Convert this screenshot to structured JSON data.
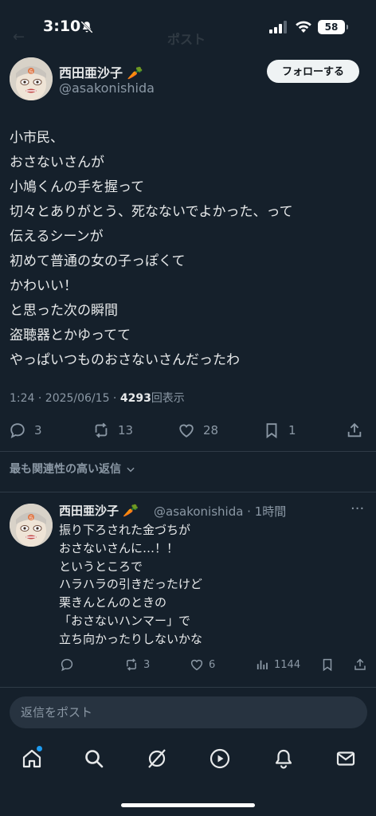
{
  "status_bar": {
    "time": "3:10",
    "battery": "58"
  },
  "header": {
    "back": "←",
    "title": "ポスト"
  },
  "tweet": {
    "author_name": "西田亜沙子",
    "author_emoji": "🥕",
    "author_handle": "@asakonishida",
    "follow_label": "フォローする",
    "lines": [
      "小市民、",
      "おさないさんが",
      "小鳩くんの手を握って",
      "切々とありがとう、死なないでよかった、って",
      "伝えるシーンが",
      "初めて普通の女の子っぽくて",
      "かわいい！",
      "と思った次の瞬間",
      "盗聴器とかゆってて",
      "やっぱいつものおさないさんだったわ"
    ],
    "meta_time": "1:24 · 2025/06/15 · ",
    "views_count": "4293",
    "views_label": "回表示",
    "replies": "3",
    "reposts": "13",
    "likes": "28",
    "bookmarks": "1"
  },
  "relevance_label": "最も関連性の高い返信",
  "reply": {
    "author_name": "西田亜沙子",
    "author_emoji": "🥕",
    "handle_time": "@asakonishida · 1時間",
    "more": "···",
    "lines": [
      "振り下ろされた金づちが",
      "おさないさんに…！！",
      "というところで",
      "ハラハラの引きだったけど",
      "栗きんとんのときの",
      "「おさないハンマー」で",
      "立ち向かったりしないかな"
    ],
    "replies": "",
    "reposts": "3",
    "likes": "6",
    "views": "1144"
  },
  "reply_input": {
    "placeholder": "返信をポスト"
  },
  "icons": {
    "accent": "#1d9bf0",
    "muted": "#8b98a5",
    "carrot": "#f28c28"
  }
}
